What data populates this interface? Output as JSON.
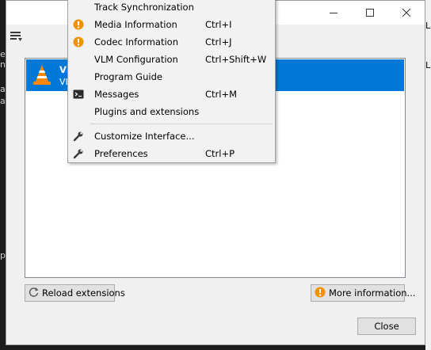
{
  "colors": {
    "selection": "#0078d7",
    "info_icon": "#f39200",
    "vlc_orange": "#ff8800"
  },
  "background_fragments": [
    "er",
    "nd",
    "ar",
    "ar",
    "pe"
  ],
  "right_edge_fragments": [
    "L",
    "L"
  ],
  "window": {
    "controls": [
      "minimize",
      "maximize",
      "close"
    ]
  },
  "extensions_list": {
    "items": [
      {
        "name": "VL",
        "description": "VL",
        "icon": "vlc-cone-icon",
        "selected": true
      }
    ]
  },
  "buttons": {
    "reload": {
      "label": "Reload extensions",
      "icon": "reload-icon"
    },
    "more_info": {
      "label": "More information...",
      "icon": "info-icon"
    },
    "close": {
      "label": "Close"
    }
  },
  "menu": {
    "items": [
      {
        "label": "Track Synchronization",
        "shortcut": "",
        "icon": ""
      },
      {
        "label": "Media Information",
        "shortcut": "Ctrl+I",
        "icon": "info-icon"
      },
      {
        "label": "Codec Information",
        "shortcut": "Ctrl+J",
        "icon": "info-icon"
      },
      {
        "label": "VLM Configuration",
        "shortcut": "Ctrl+Shift+W",
        "icon": ""
      },
      {
        "label": "Program Guide",
        "shortcut": "",
        "icon": ""
      },
      {
        "label": "Messages",
        "shortcut": "Ctrl+M",
        "icon": "terminal-icon"
      },
      {
        "label": "Plugins and extensions",
        "shortcut": "",
        "icon": ""
      },
      {
        "label": "Customize Interface...",
        "shortcut": "",
        "icon": "wrench-icon"
      },
      {
        "label": "Preferences",
        "shortcut": "Ctrl+P",
        "icon": "wrench-icon"
      }
    ]
  }
}
